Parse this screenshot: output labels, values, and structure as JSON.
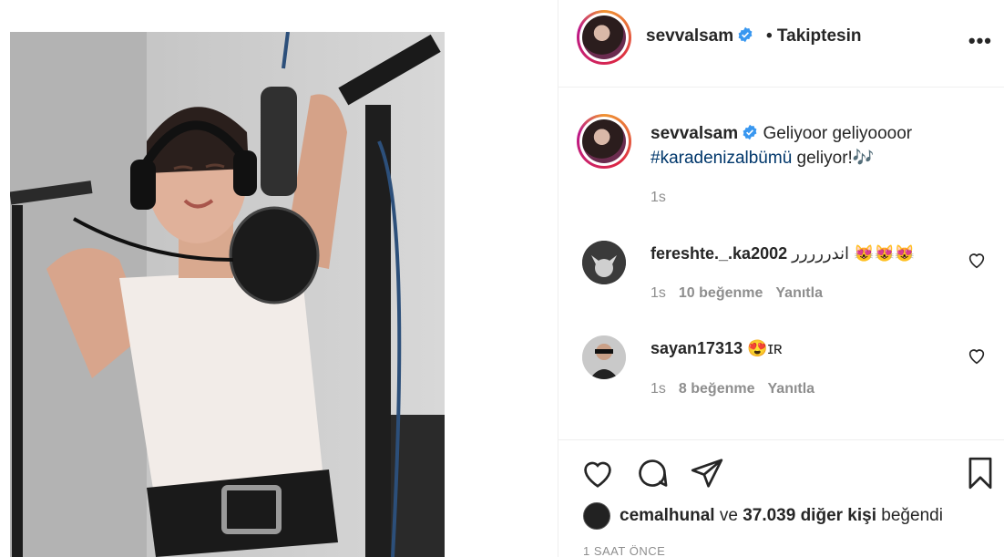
{
  "header": {
    "username": "sevvalsam",
    "follow_status": "• Takiptesin",
    "more": "•••"
  },
  "caption": {
    "username": "sevvalsam",
    "text": "Geliyoor geliyoooor",
    "hashtag": "#karadenizalbümü",
    "text_after": "geliyor!",
    "emoji": "🎶",
    "time": "1s"
  },
  "comments": [
    {
      "username": "fereshte._.ka2002",
      "text": "اندررررر 😻😻😻",
      "time": "1s",
      "likes": "10 beğenme",
      "reply": "Yanıtla"
    },
    {
      "username": "sayan17313",
      "text": "😍ɪʀ",
      "time": "1s",
      "likes": "8 beğenme",
      "reply": "Yanıtla"
    }
  ],
  "likes": {
    "user": "cemalhunal",
    "connector": "ve",
    "others": "37.039 diğer kişi",
    "suffix": "beğendi"
  },
  "timestamp": "1 SAAT ÖNCE",
  "colors": {
    "link": "#00376b",
    "verified": "#3897f0",
    "muted": "#8e8e8e",
    "text": "#262626"
  }
}
